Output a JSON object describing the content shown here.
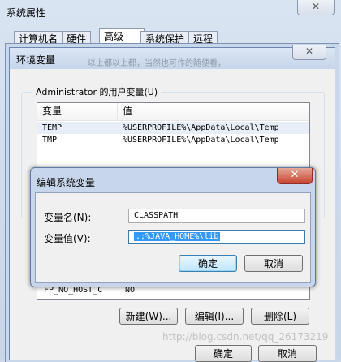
{
  "system_properties": {
    "title": "系统属性",
    "close_glyph": "✕",
    "tabs": [
      {
        "label": "计算机名"
      },
      {
        "label": "硬件"
      },
      {
        "label": "高级"
      },
      {
        "label": "系统保护"
      },
      {
        "label": "远程"
      }
    ],
    "ok_label": "确定",
    "cancel_label": "取消"
  },
  "env_window": {
    "title": "环境变量",
    "ghost_text": "以上都以上都，当然也可作的随便看，",
    "close_glyph": "✕",
    "user_group_label": "Administrator 的用户变量(U)",
    "user_vars_headers": {
      "name": "变量",
      "value": "值"
    },
    "user_vars": [
      {
        "name": "TEMP",
        "value": "%USERPROFILE%\\AppData\\Local\\Temp"
      },
      {
        "name": "TMP",
        "value": "%USERPROFILE%\\AppData\\Local\\Temp"
      }
    ],
    "system_var_partial": {
      "name": "FP_NO_HOST_C",
      "value": "NO"
    },
    "new_label": "新建(W)...",
    "edit_label": "编辑(I)...",
    "delete_label": "删除(L)"
  },
  "edit_dialog": {
    "title": "编辑系统变量",
    "close_glyph": "✕",
    "name_label": "变量名(N):",
    "name_value": "CLASSPATH",
    "value_label": "变量值(V):",
    "value_value": ".;%JAVA_HOME%\\lib",
    "ok_label": "确定",
    "cancel_label": "取消"
  },
  "watermark": "http://blog.csdn.net/qq_26173219"
}
